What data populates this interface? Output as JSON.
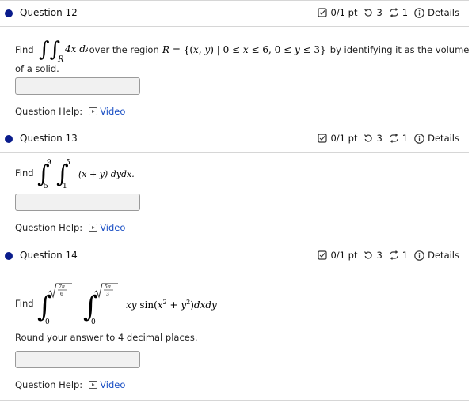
{
  "questions": [
    {
      "title": "Question 12",
      "score": "0/1 pt",
      "retries": "3",
      "attempts": "1",
      "details": "Details",
      "find": "Find",
      "prompt_tail": "over the region",
      "prompt_tail2": "by identifying it as the volume",
      "prompt_line2": "of a solid.",
      "help_label": "Question Help:",
      "video_label": "Video"
    },
    {
      "title": "Question 13",
      "score": "0/1 pt",
      "retries": "3",
      "attempts": "1",
      "details": "Details",
      "find": "Find",
      "help_label": "Question Help:",
      "video_label": "Video"
    },
    {
      "title": "Question 14",
      "score": "0/1 pt",
      "retries": "3",
      "attempts": "1",
      "details": "Details",
      "find": "Find",
      "round_note": "Round your answer to 4 decimal places.",
      "help_label": "Question Help:",
      "video_label": "Video"
    }
  ],
  "colors": {
    "dot": "#0a1c8c",
    "link": "#1a4fc4"
  }
}
